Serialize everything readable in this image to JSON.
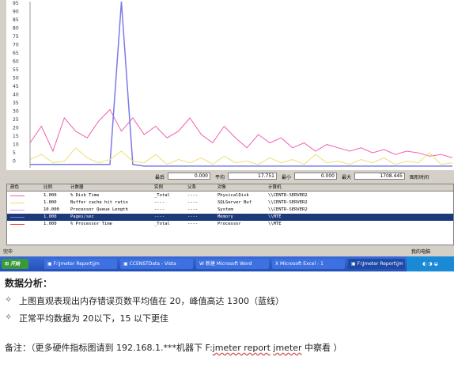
{
  "chart": {
    "yticks": [
      "95",
      "90",
      "85",
      "80",
      "75",
      "70",
      "65",
      "60",
      "55",
      "50",
      "45",
      "40",
      "35",
      "30",
      "25",
      "20",
      "15",
      "10",
      "5",
      "0"
    ],
    "colors": {
      "pink": "#f060b0",
      "blue": "#7a7ae8",
      "yellow": "#f0e070",
      "purple": "#c8a0e8",
      "white_line": "#e0e0ff"
    }
  },
  "chart_data": {
    "type": "line",
    "title": "",
    "ylim": [
      0,
      100
    ],
    "series": [
      {
        "values": [
          15,
          25,
          10,
          30,
          22,
          18,
          28,
          35,
          22,
          30,
          20,
          25,
          18,
          22,
          30,
          20,
          15,
          25,
          18,
          12,
          20,
          15,
          18,
          12,
          15,
          10,
          14,
          12,
          10,
          12,
          9,
          11,
          8,
          10,
          9,
          7,
          8,
          6
        ]
      },
      {
        "values": [
          2,
          2,
          2,
          2,
          2,
          2,
          2,
          2,
          100,
          2,
          1,
          1,
          1,
          1,
          1,
          1,
          1,
          1,
          1,
          1,
          1,
          1,
          1,
          1,
          1,
          1,
          1,
          1,
          1,
          1,
          1,
          1,
          1,
          1,
          1,
          1,
          1,
          1
        ]
      },
      {
        "values": [
          5,
          8,
          3,
          4,
          12,
          6,
          3,
          5,
          10,
          4,
          3,
          8,
          2,
          5,
          3,
          6,
          2,
          7,
          3,
          4,
          2,
          6,
          3,
          5,
          2,
          8,
          3,
          4,
          2,
          5,
          3,
          6,
          2,
          4,
          3,
          9,
          2,
          3
        ]
      }
    ]
  },
  "stats": {
    "last_label": "最后",
    "last_value": "0.000",
    "avg_label": "平均",
    "avg_value": "17.751",
    "min_label": "最小",
    "min_value": "0.000",
    "max_label": "最大",
    "max_value": "1708.445",
    "duration_label": "图形时间"
  },
  "counters": {
    "headers": [
      "颜色",
      "比例",
      "计数器",
      "实例",
      "父系",
      "对象",
      "计算机"
    ],
    "rows": [
      {
        "scale": "1.000",
        "counter": "% Disk Time",
        "instance": "_Total",
        "parent": "----",
        "object": "PhysicalDisk",
        "computer": "\\\\CENTR-SERVER2",
        "color": "#f060b0"
      },
      {
        "scale": "1.000",
        "counter": "Buffer cache hit ratio",
        "instance": "----",
        "parent": "----",
        "object": "SQLServer Buf",
        "computer": "\\\\CENTR-SERVER2",
        "color": "#f0e070"
      },
      {
        "scale": "10.000",
        "counter": "Processor Queue Length",
        "instance": "----",
        "parent": "----",
        "object": "System",
        "computer": "\\\\CENTR-SERVER2",
        "color": "#c8a0e8"
      },
      {
        "scale": "1.000",
        "counter": "Pages/sec",
        "instance": "----",
        "parent": "----",
        "object": "Memory",
        "computer": "\\\\MTE",
        "color": "#7a7ae8"
      },
      {
        "scale": "1.000",
        "counter": "% Processor Time",
        "instance": "_Total",
        "parent": "----",
        "object": "Processor",
        "computer": "\\\\MTE",
        "color": "#e04040"
      }
    ]
  },
  "statusbar": {
    "left": "完毕",
    "right": "我的电脑"
  },
  "taskbar": {
    "start": "开始",
    "items": [
      "F:\\Jmeter Report\\jm",
      "CCENSTData - Vista",
      "新建 Microsoft Word",
      "Microsoft Excel - 1",
      "F:\\Jmeter Report\\jm"
    ]
  },
  "notes": {
    "title": "数据分析：",
    "bullets": [
      "上图直观表现出内存错误页数平均值在 20，峰值高达 1300（蓝线）",
      "正常平均数据为 20以下，15 以下更佳"
    ],
    "remark_prefix": "备注：（更多硬件指标图请到 192.168.1.***机器下 F:",
    "remark_path1": "jmeter report",
    "remark_path2": "jmeter",
    "remark_suffix": " 中察看 ）"
  }
}
